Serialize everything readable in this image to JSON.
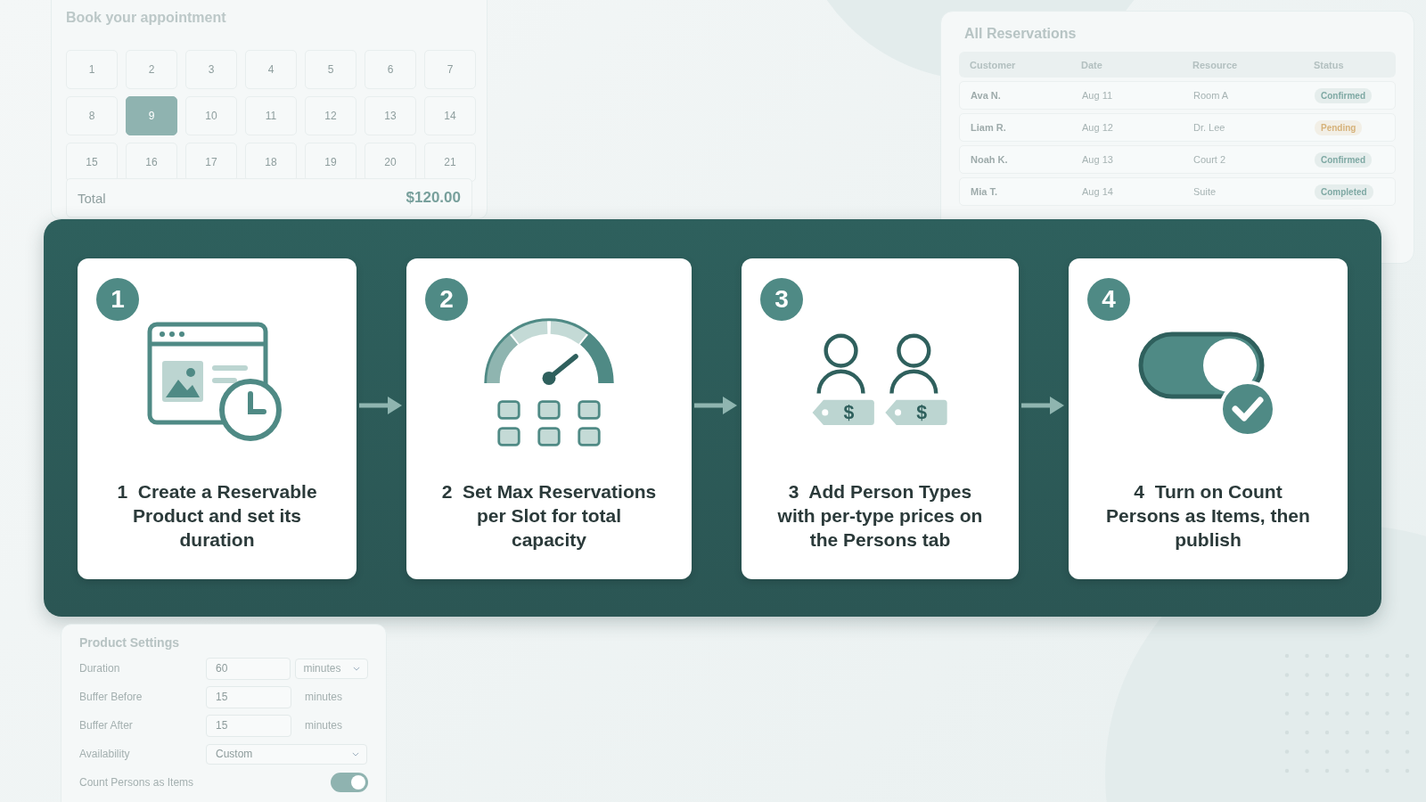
{
  "booking": {
    "title": "Book your appointment",
    "days": [
      {
        "label": "1",
        "selected": false
      },
      {
        "label": "2",
        "selected": false
      },
      {
        "label": "3",
        "selected": false
      },
      {
        "label": "4",
        "selected": false
      },
      {
        "label": "5",
        "selected": false
      },
      {
        "label": "6",
        "selected": false
      },
      {
        "label": "7",
        "selected": false
      },
      {
        "label": "8",
        "selected": false
      },
      {
        "label": "9",
        "selected": true
      },
      {
        "label": "10",
        "selected": false
      },
      {
        "label": "11",
        "selected": false
      },
      {
        "label": "12",
        "selected": false
      },
      {
        "label": "13",
        "selected": false
      },
      {
        "label": "14",
        "selected": false
      },
      {
        "label": "15",
        "selected": false
      },
      {
        "label": "16",
        "selected": false
      },
      {
        "label": "17",
        "selected": false
      },
      {
        "label": "18",
        "selected": false
      },
      {
        "label": "19",
        "selected": false
      },
      {
        "label": "20",
        "selected": false
      },
      {
        "label": "21",
        "selected": false
      }
    ],
    "total_label": "Total",
    "total": "$120.00"
  },
  "reservations": {
    "title": "All Reservations",
    "columns": [
      "Customer",
      "Date",
      "Resource",
      "Status"
    ],
    "rows": [
      {
        "customer": "Ava N.",
        "date": "Aug 11",
        "resource": "Room A",
        "status": "Confirmed",
        "color": "#7fa9a4"
      },
      {
        "customer": "Liam R.",
        "date": "Aug 12",
        "resource": "Dr. Lee",
        "status": "Pending",
        "color": "#d6b27a"
      },
      {
        "customer": "Noah K.",
        "date": "Aug 13",
        "resource": "Court 2",
        "status": "Confirmed",
        "color": "#7fa9a4"
      },
      {
        "customer": "Mia T.",
        "date": "Aug 14",
        "resource": "Suite",
        "status": "Completed",
        "color": "#7fa9a4"
      }
    ]
  },
  "steps": [
    {
      "number": "1",
      "kind": "product",
      "text": "1  Create a Reservable Product and set its duration"
    },
    {
      "number": "2",
      "kind": "capacity",
      "text": "2  Set Max Reservations per Slot for total capacity"
    },
    {
      "number": "3",
      "kind": "persons",
      "tags": [
        "$",
        "$"
      ],
      "text": "3  Add Person Types with per-type prices on the Persons tab"
    },
    {
      "number": "4",
      "kind": "toggle",
      "text": "4  Turn on Count Persons as Items, then publish"
    }
  ],
  "settings": {
    "title": "Product Settings",
    "rows": [
      {
        "kind": "input-select",
        "label": "Duration",
        "value": "60",
        "unit": "minutes"
      },
      {
        "kind": "input-unit",
        "label": "Buffer Before",
        "value": "15",
        "unit": "minutes"
      },
      {
        "kind": "input-unit",
        "label": "Buffer After",
        "value": "15",
        "unit": "minutes"
      },
      {
        "kind": "select",
        "label": "Availability",
        "value": "Custom"
      },
      {
        "kind": "toggle",
        "label": "Count Persons as Items",
        "on": true
      }
    ]
  }
}
